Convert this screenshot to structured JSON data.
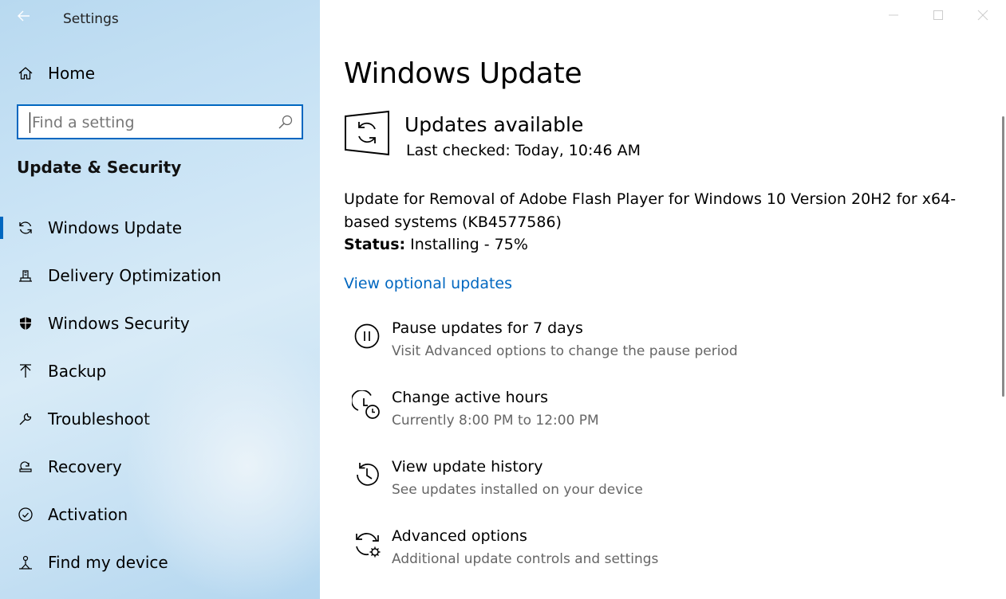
{
  "window": {
    "app_title": "Settings"
  },
  "sidebar": {
    "home_label": "Home",
    "search": {
      "placeholder": "Find a setting",
      "value": ""
    },
    "section_title": "Update & Security",
    "items": [
      {
        "label": "Windows Update",
        "icon": "sync-icon",
        "selected": true
      },
      {
        "label": "Delivery Optimization",
        "icon": "delivery-optimization-icon",
        "selected": false
      },
      {
        "label": "Windows Security",
        "icon": "shield-icon",
        "selected": false
      },
      {
        "label": "Backup",
        "icon": "backup-arrow-icon",
        "selected": false
      },
      {
        "label": "Troubleshoot",
        "icon": "wrench-icon",
        "selected": false
      },
      {
        "label": "Recovery",
        "icon": "recovery-icon",
        "selected": false
      },
      {
        "label": "Activation",
        "icon": "check-circle-icon",
        "selected": false
      },
      {
        "label": "Find my device",
        "icon": "person-location-icon",
        "selected": false
      }
    ]
  },
  "main": {
    "title": "Windows Update",
    "status": {
      "heading": "Updates available",
      "last_checked": "Last checked: Today, 10:46 AM"
    },
    "update": {
      "description": "Update for Removal of Adobe Flash Player for Windows 10 Version 20H2 for x64-based systems (KB4577586)",
      "status_label": "Status:",
      "status_value": "Installing - 75%"
    },
    "optional_link": "View optional updates",
    "options": [
      {
        "title": "Pause updates for 7 days",
        "subtitle": "Visit Advanced options to change the pause period",
        "icon": "pause-icon"
      },
      {
        "title": "Change active hours",
        "subtitle": "Currently 8:00 PM to 12:00 PM",
        "icon": "active-hours-icon"
      },
      {
        "title": "View update history",
        "subtitle": "See updates installed on your device",
        "icon": "history-icon"
      },
      {
        "title": "Advanced options",
        "subtitle": "Additional update controls and settings",
        "icon": "advanced-options-icon"
      }
    ]
  },
  "colors": {
    "accent": "#0067c0",
    "sidebar_bg": "#c9e3f5",
    "subtext": "#666666"
  }
}
